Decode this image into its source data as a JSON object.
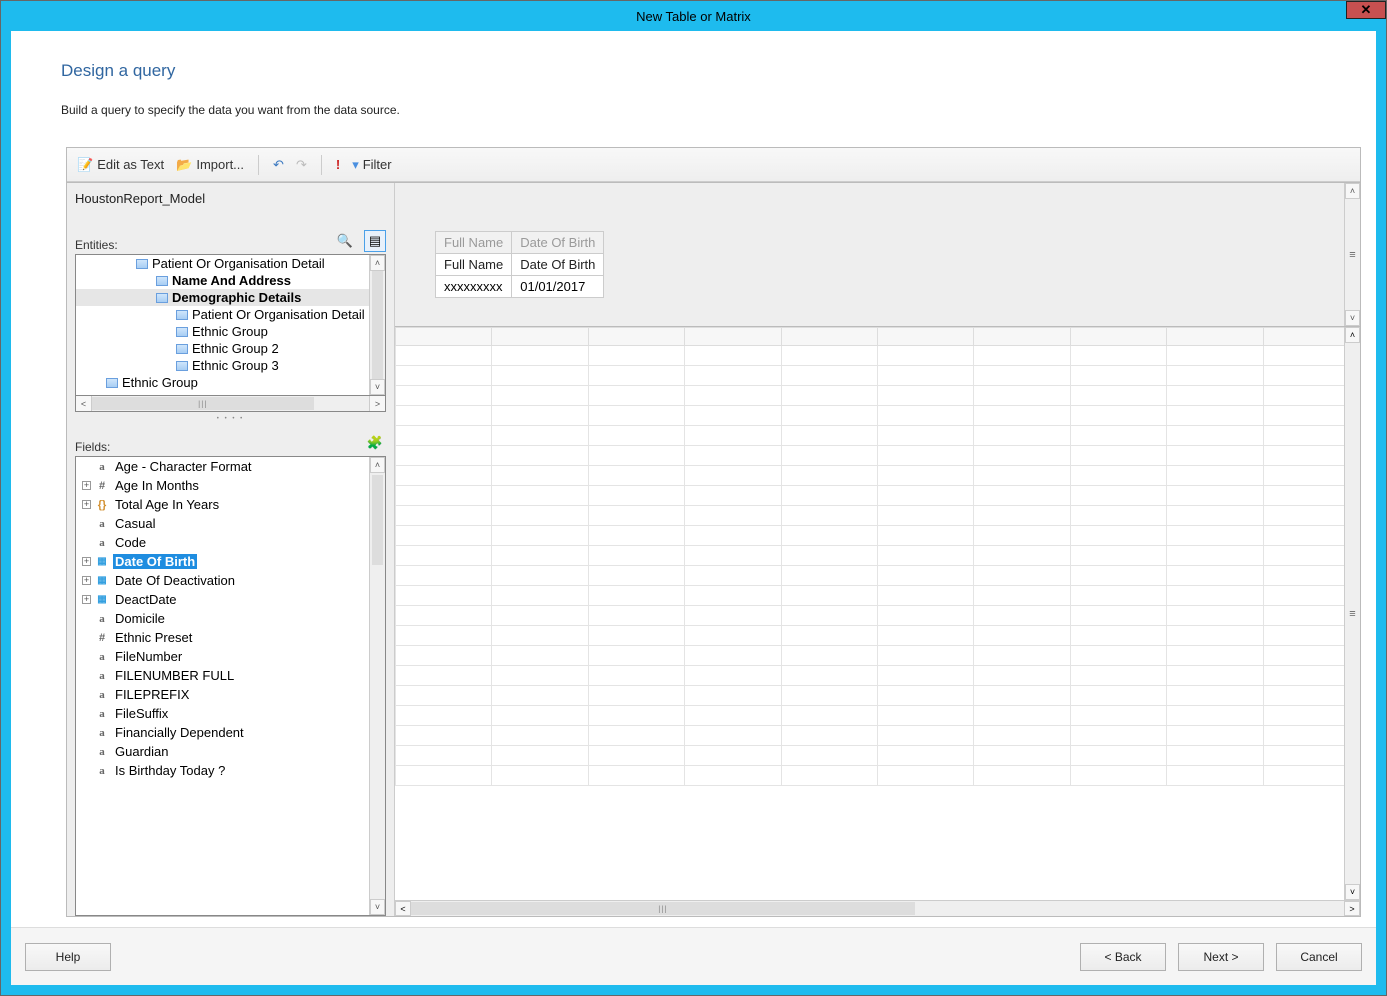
{
  "window": {
    "title": "New Table or Matrix"
  },
  "page": {
    "heading": "Design a query",
    "subheading": "Build a query to specify the data you want from the data source."
  },
  "toolbar": {
    "edit_as_text": "Edit as Text",
    "import": "Import...",
    "filter": "Filter"
  },
  "model": {
    "name": "HoustonReport_Model"
  },
  "entities_label": "Entities:",
  "entities": [
    {
      "label": "Patient Or Organisation Detail",
      "level": 0,
      "bold": false
    },
    {
      "label": "Name And Address",
      "level": 1,
      "bold": true
    },
    {
      "label": "Demographic Details",
      "level": 1,
      "bold": true,
      "selected": true
    },
    {
      "label": "Patient Or Organisation Detail",
      "level": 2,
      "bold": false
    },
    {
      "label": "Ethnic Group",
      "level": 2,
      "bold": false
    },
    {
      "label": "Ethnic Group 2",
      "level": 2,
      "bold": false
    },
    {
      "label": "Ethnic Group 3",
      "level": 2,
      "bold": false
    },
    {
      "label": "Ethnic Group",
      "level": "0cut",
      "bold": false
    }
  ],
  "fields_label": "Fields:",
  "fields": [
    {
      "name": "Age - Character Format",
      "type": "a",
      "exp": false
    },
    {
      "name": "Age In Months",
      "type": "hash",
      "exp": true
    },
    {
      "name": "Total Age In Years",
      "type": "brace",
      "exp": true
    },
    {
      "name": "Casual",
      "type": "a",
      "exp": false
    },
    {
      "name": "Code",
      "type": "a",
      "exp": false
    },
    {
      "name": "Date Of Birth",
      "type": "cal",
      "exp": true,
      "selected": true
    },
    {
      "name": "Date Of Deactivation",
      "type": "cal",
      "exp": true
    },
    {
      "name": "DeactDate",
      "type": "cal",
      "exp": true
    },
    {
      "name": "Domicile",
      "type": "a",
      "exp": false
    },
    {
      "name": "Ethnic Preset",
      "type": "hash",
      "exp": false
    },
    {
      "name": "FileNumber",
      "type": "a",
      "exp": false
    },
    {
      "name": "FILENUMBER FULL",
      "type": "a",
      "exp": false
    },
    {
      "name": "FILEPREFIX",
      "type": "a",
      "exp": false
    },
    {
      "name": "FileSuffix",
      "type": "a",
      "exp": false
    },
    {
      "name": "Financially Dependent",
      "type": "a",
      "exp": false
    },
    {
      "name": "Guardian",
      "type": "a",
      "exp": false
    },
    {
      "name": "Is Birthday Today ?",
      "type": "a",
      "exp": false
    }
  ],
  "preview": {
    "col_headers": [
      "Full Name",
      "Date Of Birth"
    ],
    "headers": [
      "Full Name",
      "Date Of Birth"
    ],
    "row": [
      "xxxxxxxxx",
      "01/01/2017"
    ]
  },
  "buttons": {
    "help": "Help",
    "back": "<  Back",
    "next": "Next  >",
    "cancel": "Cancel"
  }
}
